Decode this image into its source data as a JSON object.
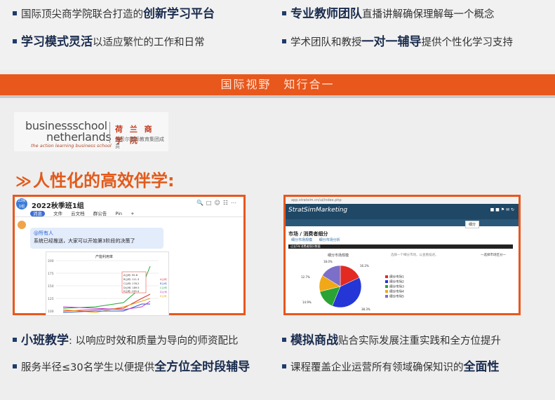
{
  "top_bullets": [
    {
      "pre": "国际顶尖商学院联合打造的",
      "bold": "创新学习平台",
      "post": ""
    },
    {
      "pre": "",
      "bold": "专业教师团队",
      "post": "直播讲解确保理解每一个概念"
    },
    {
      "pre": "",
      "bold": "学习模式灵活",
      "post": "以适应繁忙的工作和日常"
    },
    {
      "pre": "学术团队和教授",
      "bold": "一对一辅导",
      "post": "提供个性化学习支持"
    }
  ],
  "band": {
    "text": "国际视野　知行合一"
  },
  "logo": {
    "line1": "businessschool",
    "line2": "netherlands",
    "tagline": "the action learning business school",
    "cn_name": "荷 兰 商 学 院",
    "cn_sub": "诺贝尔国际教育集团成员"
  },
  "heading": {
    "text": "人性化的高效伴学:"
  },
  "group_chat": {
    "title": "2022秋季班1组",
    "tabs": [
      "消息",
      "文件",
      "云文档",
      "群公告",
      "Pin",
      "+"
    ],
    "mention": "@所有人",
    "message": "系统已经推送，大家可以开始第3阶段的决策了",
    "chart_title": "产能利用率",
    "y_ticks": [
      "200",
      "175",
      "150",
      "125",
      "100"
    ],
    "tooltip": [
      "A公司: 95.8",
      "B公司: 111.3",
      "C公司: 178.2",
      "D公司: 189.5",
      "E公司: 199.4"
    ],
    "legend": [
      "A公司",
      "B公司",
      "C公司",
      "D公司",
      "E公司"
    ]
  },
  "sim": {
    "url": "app.stratsim.cn/ui/index.php",
    "brand": "StratSimMarketing",
    "title": "市场 / 消费者细分",
    "tabs": [
      "细分市场规模",
      "细分市场分析"
    ],
    "dark_label": "过去5年消费者细分数据",
    "pie_title": "细分市场规模",
    "hint": "选择一个细分市场，以查看描述。",
    "select": "一选择市场区分一",
    "tip": "细分",
    "pie_labels": [
      "18.0%",
      "16.2%",
      "12.7%",
      "14.9%",
      "38.3%"
    ],
    "legend": [
      "细分市场1",
      "细分市场2",
      "细分市场3",
      "细分市场4",
      "细分市场5"
    ],
    "slices": [
      18.0,
      38.3,
      14.9,
      12.7,
      16.2
    ]
  },
  "bottom_bullets": [
    {
      "pre": "",
      "bold": "小班教学",
      "post": ": 以响应时效和质量为导向的师资配比"
    },
    {
      "pre": "",
      "bold": "模拟商战",
      "post": "贴合实际发展注重实践和全方位提升"
    },
    {
      "pre": "服务半径≤30名学生以便提供",
      "bold": "全方位全时段辅导",
      "post": ""
    },
    {
      "pre": "课程覆盖企业运营所有领域确保知识的",
      "bold": "全面性",
      "post": ""
    }
  ],
  "colors": {
    "accent": "#e8571c",
    "navy": "#1a2c4e",
    "sim_bar": "#1f4766"
  }
}
